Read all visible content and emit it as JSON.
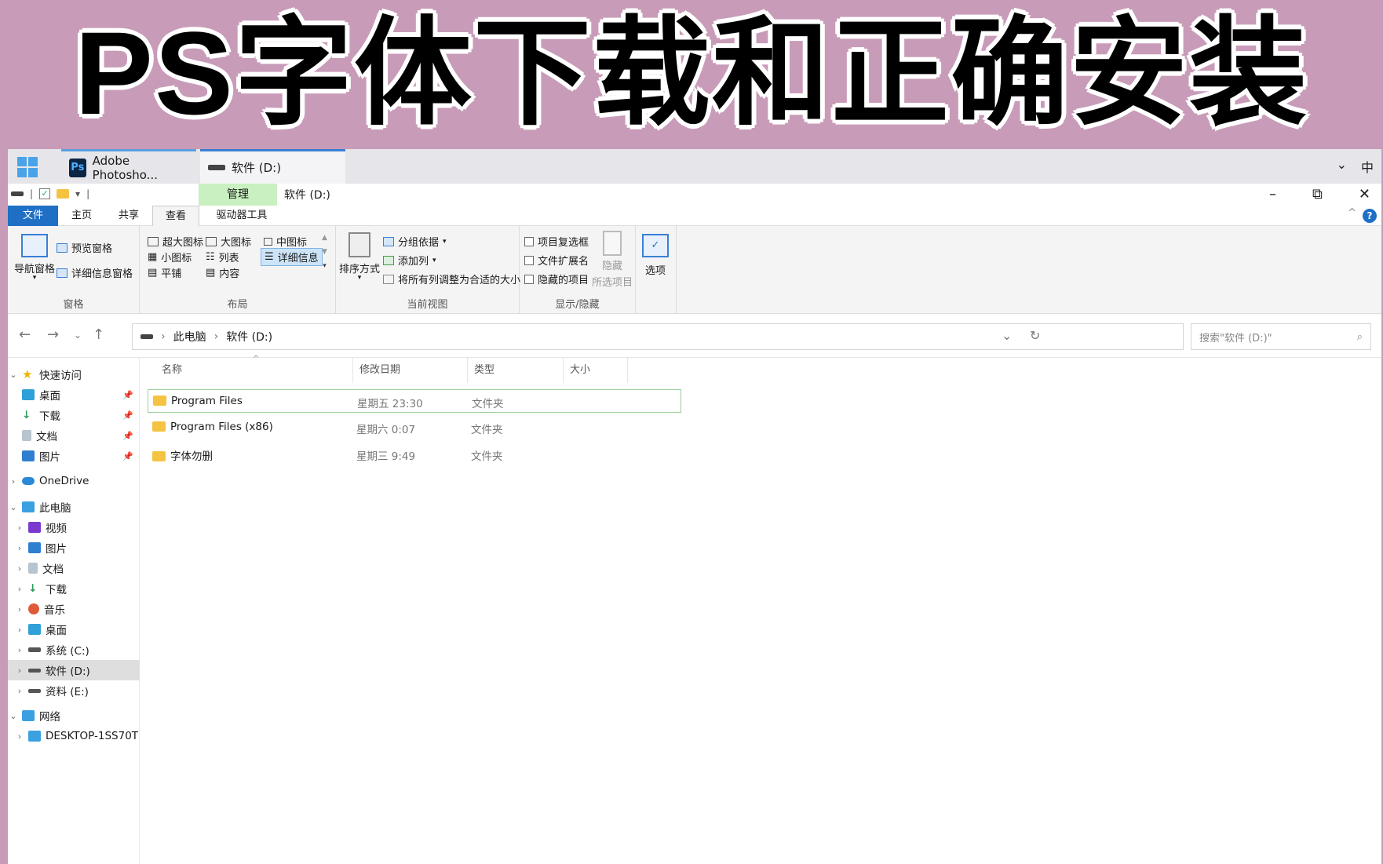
{
  "banner": {
    "title": "PS字体下载和正确安装"
  },
  "taskbar": {
    "tabs": [
      {
        "label": "Adobe Photosho..."
      },
      {
        "label": "软件 (D:)"
      }
    ],
    "ime": "中"
  },
  "titlebar": {
    "manage": "管理",
    "title": "软件 (D:)"
  },
  "ribbon_tabs": {
    "file": "文件",
    "home": "主页",
    "share": "共享",
    "view": "查看",
    "drive_tools": "驱动器工具"
  },
  "ribbon": {
    "panes": {
      "label": "窗格",
      "nav_pane": "导航窗格",
      "preview": "预览窗格",
      "details": "详细信息窗格"
    },
    "layout": {
      "label": "布局",
      "items": [
        "超大图标",
        "大图标",
        "中图标",
        "小图标",
        "列表",
        "详细信息",
        "平铺",
        "内容"
      ]
    },
    "current_view": {
      "label": "当前视图",
      "sort": "排序方式",
      "group_by": "分组依据",
      "add_col": "添加列",
      "fit_cols": "将所有列调整为合适的大小"
    },
    "show_hide": {
      "label": "显示/隐藏",
      "item_checkbox": "项目复选框",
      "ext": "文件扩展名",
      "hidden": "隐藏的项目",
      "hide": "隐藏",
      "hide_selected": "所选项目"
    },
    "options": "选项"
  },
  "address": {
    "crumbs": [
      "此电脑",
      "软件 (D:)"
    ],
    "search_placeholder": "搜索\"软件 (D:)\""
  },
  "nav_pane": {
    "quick_access": "快速访问",
    "qa_items": [
      "桌面",
      "下载",
      "文档",
      "图片"
    ],
    "onedrive": "OneDrive",
    "this_pc": "此电脑",
    "pc_items": [
      "视频",
      "图片",
      "文档",
      "下载",
      "音乐",
      "桌面",
      "系统 (C:)",
      "软件 (D:)",
      "资料 (E:)"
    ],
    "network": "网络",
    "network_items": [
      "DESKTOP-1SS70T"
    ]
  },
  "columns": {
    "name": "名称",
    "date": "修改日期",
    "type": "类型",
    "size": "大小"
  },
  "files": [
    {
      "name": "Program Files",
      "date": "星期五 23:30",
      "type": "文件夹"
    },
    {
      "name": "Program Files (x86)",
      "date": "星期六 0:07",
      "type": "文件夹"
    },
    {
      "name": "字体勿删",
      "date": "星期三 9:49",
      "type": "文件夹"
    }
  ]
}
